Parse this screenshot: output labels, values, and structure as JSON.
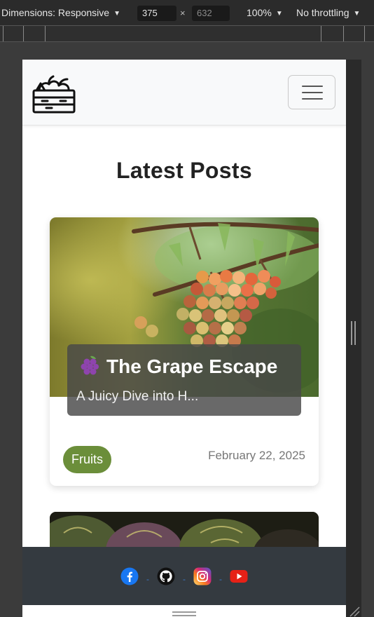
{
  "devtools": {
    "dimensions_label": "Dimensions: Responsive",
    "width_value": "375",
    "height_placeholder": "632",
    "times": "×",
    "zoom": "100%",
    "throttling": "No throttling"
  },
  "site": {
    "heading": "Latest Posts",
    "posts": [
      {
        "title": "The Grape Escape",
        "subtitle": "A Juicy Dive into H...",
        "category": "Fruits",
        "date": "February 22, 2025"
      }
    ],
    "footer": {
      "social": [
        "facebook-icon",
        "github-icon",
        "instagram-icon",
        "youtube-icon"
      ],
      "separator": "-"
    }
  },
  "colors": {
    "badge": "#6b8e3a",
    "footer": "#343a40",
    "navbar": "#f8f9fa"
  }
}
